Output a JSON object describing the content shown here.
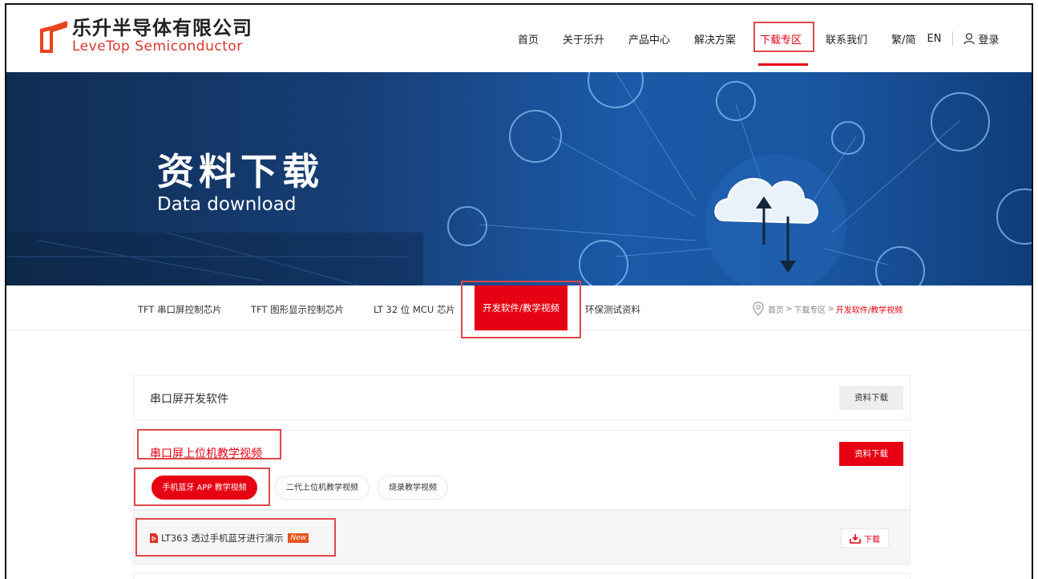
{
  "header": {
    "logo_cn": "乐升半导体有限公司",
    "logo_en": "LeveTop Semiconductor",
    "nav": [
      {
        "label": "首页"
      },
      {
        "label": "关于乐升"
      },
      {
        "label": "产品中心"
      },
      {
        "label": "解决方案"
      },
      {
        "label": "下载专区",
        "active": true
      },
      {
        "label": "联系我们"
      }
    ],
    "lang_switch": "繁/简",
    "lang_en": "EN",
    "login": "登录"
  },
  "banner": {
    "title": "资料下载",
    "subtitle": "Data download"
  },
  "subnav": {
    "items": [
      {
        "label": "TFT 串口屏控制芯片"
      },
      {
        "label": "TFT 图形显示控制芯片"
      },
      {
        "label": "LT 32 位 MCU 芯片"
      },
      {
        "label": "开发软件/教学视频",
        "active": true
      },
      {
        "label": "环保测试资料"
      }
    ],
    "breadcrumb": {
      "home": "首页",
      "sep": ">",
      "level2": "下载专区",
      "current": "开发软件/教学视频"
    }
  },
  "sections": {
    "serial_software": {
      "title": "串口屏开发软件",
      "button": "资料下载"
    },
    "serial_videos": {
      "title": "串口屏上位机教学视频",
      "button": "资料下载",
      "tabs": [
        {
          "label": "手机蓝牙 APP 教学视频",
          "active": true
        },
        {
          "label": "二代上位机教学视频"
        },
        {
          "label": "烧录教学视频"
        }
      ],
      "files": [
        {
          "name": "LT363 透过手机蓝牙进行演示",
          "badge": "New",
          "download": "下载"
        }
      ]
    }
  },
  "colors": {
    "accent": "#e60012",
    "highlight_box": "#e0484a",
    "banner_dark": "#0f2d52",
    "banner_light": "#1b5aa8"
  }
}
